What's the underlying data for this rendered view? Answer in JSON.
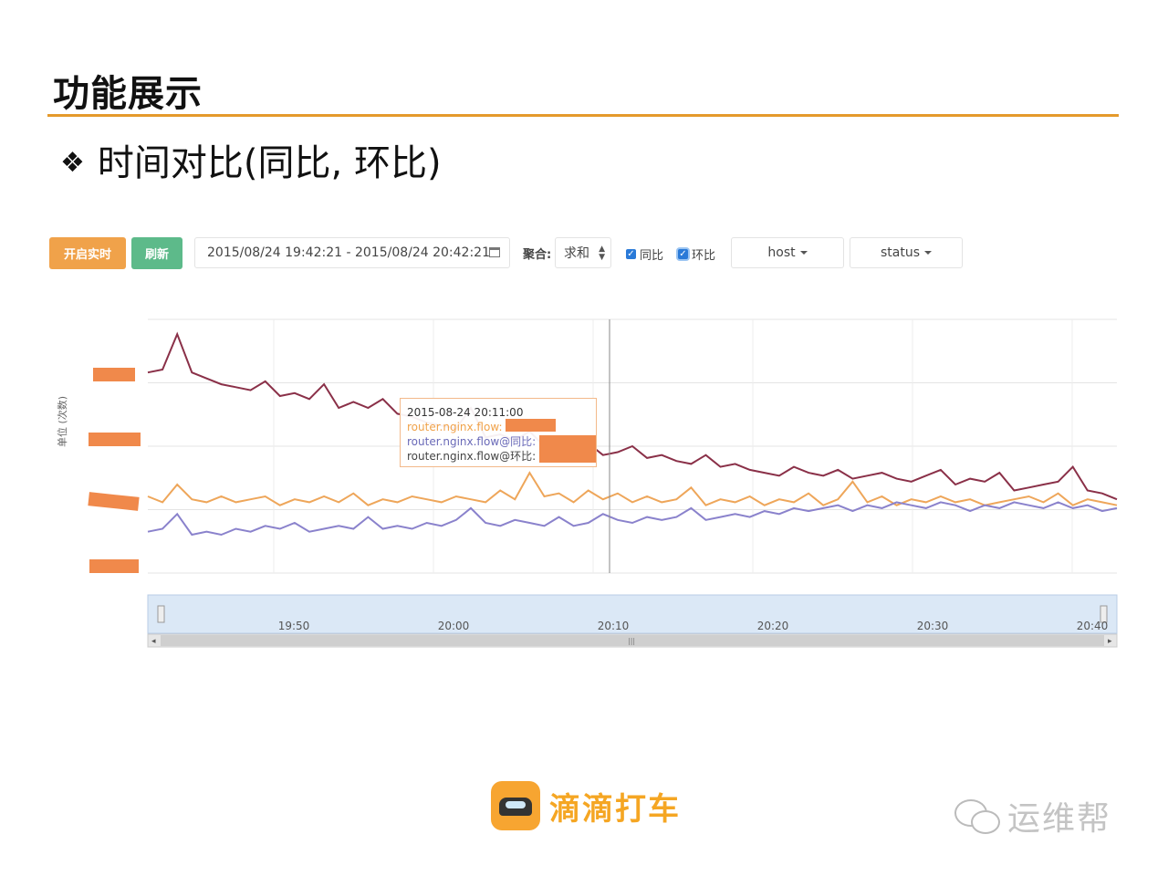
{
  "slide": {
    "title": "功能展示",
    "bullet_mark": "❖",
    "bullet_text": "时间对比(同比, 环比)"
  },
  "toolbar": {
    "realtime_label": "开启实时",
    "refresh_label": "刷新",
    "date_range": "2015/08/24 19:42:21 - 2015/08/24 20:42:21",
    "agg_label": "聚合:",
    "agg_value": "求和",
    "yoy_label": "同比",
    "mom_label": "环比",
    "host_label": "host",
    "status_label": "status",
    "colors": {
      "realtime": "#f0a24a",
      "refresh": "#5dba8a",
      "checkbox": "#2a7ad8"
    },
    "icons": [
      "calendar-icon",
      "sort-arrows-icon",
      "caret-down-icon",
      "check-icon"
    ]
  },
  "tooltip": {
    "time": "2015-08-24 20:11:00",
    "rows": [
      "router.nginx.flow:",
      "router.nginx.flow@同比:",
      "router.nginx.flow@环比:"
    ]
  },
  "footer": {
    "brand": "滴滴打车",
    "watermark": "运维帮",
    "icons": [
      "didi-taxi-logo-icon",
      "wechat-icon"
    ]
  },
  "chart_data": {
    "type": "line",
    "ylabel": "单位 (次数)",
    "x_ticks": [
      "19:50",
      "20:00",
      "20:10",
      "20:20",
      "20:30",
      "20:40"
    ],
    "x_range": [
      "2015-08-24 19:42:21",
      "2015-08-24 20:42:21"
    ],
    "grid": true,
    "crosshair_time": "20:11",
    "series": [
      {
        "name": "router.nginx.flow",
        "color": "#8a3048",
        "values": [
          6.8,
          6.9,
          8.1,
          6.8,
          6.6,
          6.4,
          6.3,
          6.2,
          6.5,
          6.0,
          6.1,
          5.9,
          6.4,
          5.6,
          5.8,
          5.6,
          5.9,
          5.4,
          5.3,
          5.1,
          5.0,
          4.9,
          5.6,
          4.6,
          4.7,
          4.5,
          4.8,
          4.3,
          4.4,
          4.2,
          4.4,
          4.0,
          4.1,
          4.3,
          3.9,
          4.0,
          3.8,
          3.7,
          4.0,
          3.6,
          3.7,
          3.5,
          3.4,
          3.3,
          3.6,
          3.4,
          3.3,
          3.5,
          3.2,
          3.3,
          3.4,
          3.2,
          3.1,
          3.3,
          3.5,
          3.0,
          3.2,
          3.1,
          3.4,
          2.8,
          2.9,
          3.0,
          3.1,
          3.6,
          2.8,
          2.7,
          2.5
        ]
      },
      {
        "name": "router.nginx.flow@同比",
        "color": "#eea65a",
        "values": [
          2.6,
          2.4,
          3.0,
          2.5,
          2.4,
          2.6,
          2.4,
          2.5,
          2.6,
          2.3,
          2.5,
          2.4,
          2.6,
          2.4,
          2.7,
          2.3,
          2.5,
          2.4,
          2.6,
          2.5,
          2.4,
          2.6,
          2.5,
          2.4,
          2.8,
          2.5,
          3.4,
          2.6,
          2.7,
          2.4,
          2.8,
          2.5,
          2.7,
          2.4,
          2.6,
          2.4,
          2.5,
          2.9,
          2.3,
          2.5,
          2.4,
          2.6,
          2.3,
          2.5,
          2.4,
          2.7,
          2.3,
          2.5,
          3.1,
          2.4,
          2.6,
          2.3,
          2.5,
          2.4,
          2.6,
          2.4,
          2.5,
          2.3,
          2.4,
          2.5,
          2.6,
          2.4,
          2.7,
          2.3,
          2.5,
          2.4,
          2.3
        ]
      },
      {
        "name": "router.nginx.flow@环比",
        "color": "#8a82cc",
        "values": [
          1.4,
          1.5,
          2.0,
          1.3,
          1.4,
          1.3,
          1.5,
          1.4,
          1.6,
          1.5,
          1.7,
          1.4,
          1.5,
          1.6,
          1.5,
          1.9,
          1.5,
          1.6,
          1.5,
          1.7,
          1.6,
          1.8,
          2.2,
          1.7,
          1.6,
          1.8,
          1.7,
          1.6,
          1.9,
          1.6,
          1.7,
          2.0,
          1.8,
          1.7,
          1.9,
          1.8,
          1.9,
          2.2,
          1.8,
          1.9,
          2.0,
          1.9,
          2.1,
          2.0,
          2.2,
          2.1,
          2.2,
          2.3,
          2.1,
          2.3,
          2.2,
          2.4,
          2.3,
          2.2,
          2.4,
          2.3,
          2.1,
          2.3,
          2.2,
          2.4,
          2.3,
          2.2,
          2.4,
          2.2,
          2.3,
          2.1,
          2.2
        ]
      }
    ]
  }
}
